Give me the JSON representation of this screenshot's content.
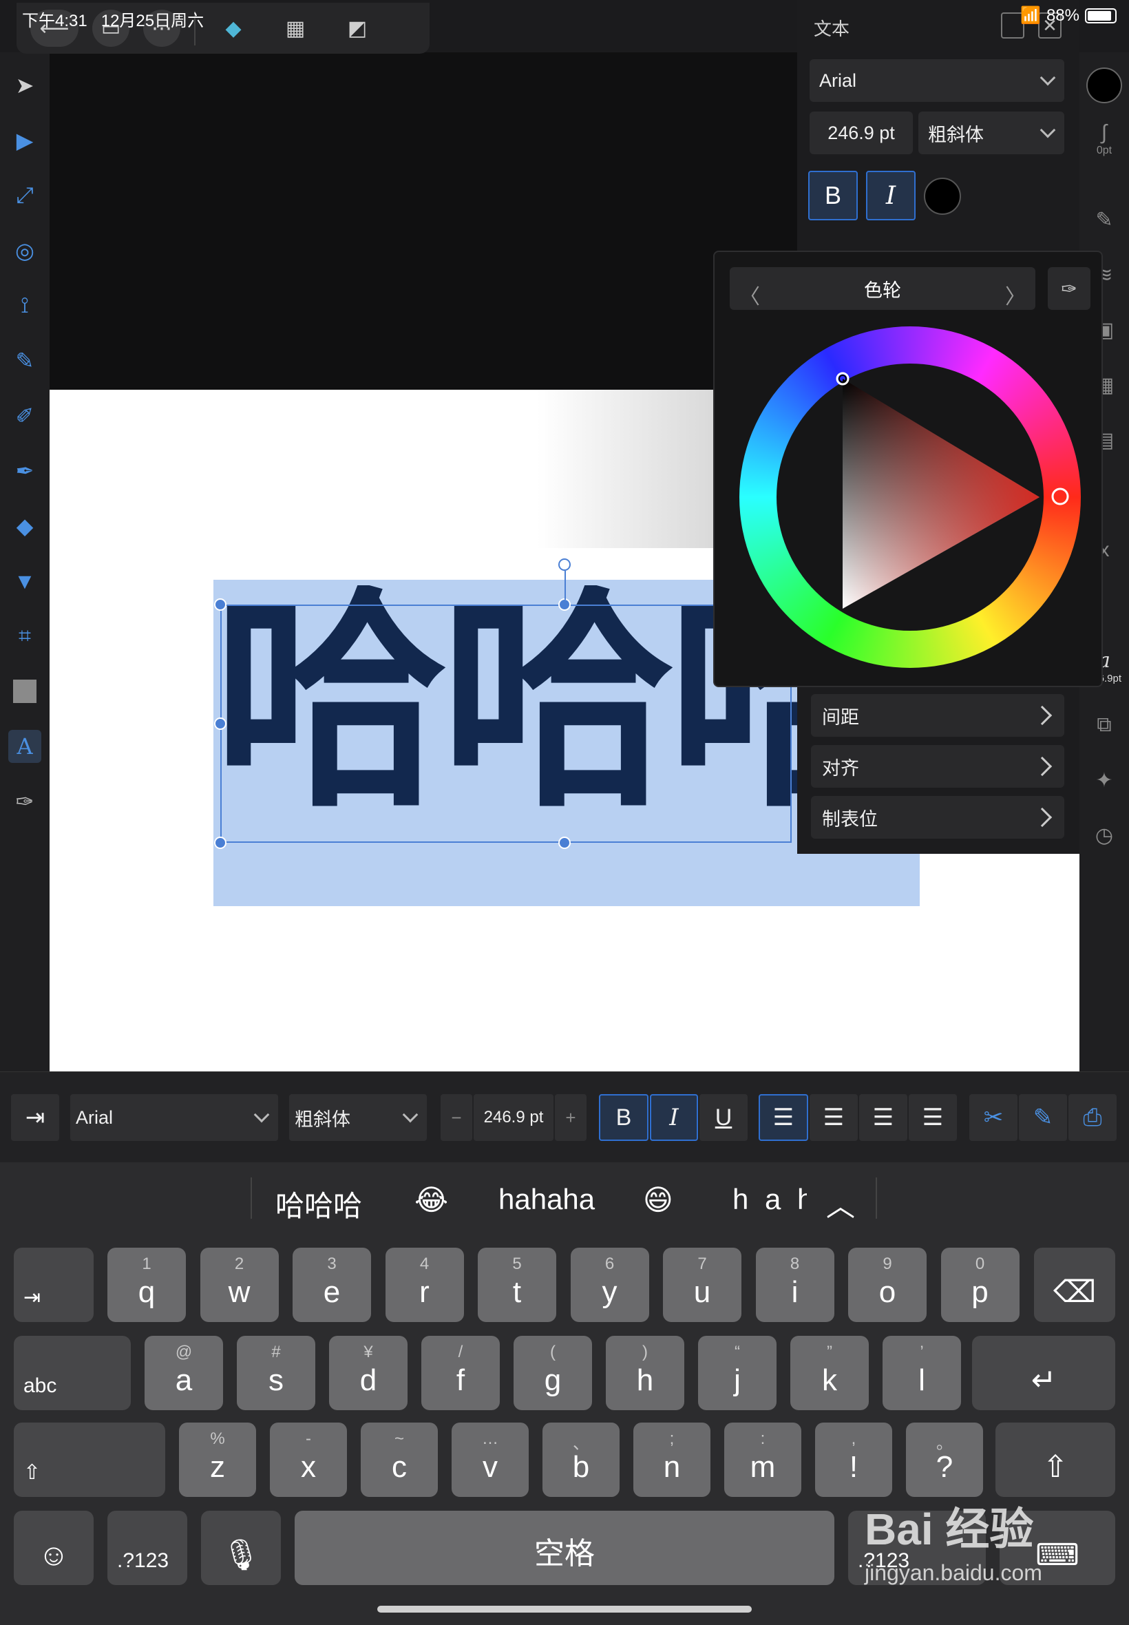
{
  "status": {
    "time": "下午4:31",
    "date": "12月25日周六",
    "battery": "88%"
  },
  "panel": {
    "title": "文本",
    "font": "Arial",
    "size": "246.9 pt",
    "style": "粗斜体",
    "bold": "B",
    "italic": "I",
    "spacing": "间距",
    "align": "对齐",
    "tabs": "制表位"
  },
  "color_popover": {
    "mode": "色轮"
  },
  "canvas": {
    "text": "哈哈哈"
  },
  "right_toolbar": {
    "stroke_width": "0pt",
    "size_label": "246.9pt"
  },
  "context_toolbar": {
    "font": "Arial",
    "style": "粗斜体",
    "size": "246.9 pt",
    "minus": "−",
    "plus": "+",
    "bold": "B",
    "italic": "I",
    "underline": "U"
  },
  "keyboard": {
    "suggestions": [
      "哈哈哈",
      "😂",
      "hahaha",
      "😄",
      "h a h"
    ],
    "row1": [
      [
        "q",
        "1"
      ],
      [
        "w",
        "2"
      ],
      [
        "e",
        "3"
      ],
      [
        "r",
        "4"
      ],
      [
        "t",
        "5"
      ],
      [
        "y",
        "6"
      ],
      [
        "u",
        "7"
      ],
      [
        "i",
        "8"
      ],
      [
        "o",
        "9"
      ],
      [
        "p",
        "0"
      ]
    ],
    "row2": [
      [
        "a",
        "@"
      ],
      [
        "s",
        "#"
      ],
      [
        "d",
        "¥"
      ],
      [
        "f",
        "/"
      ],
      [
        "g",
        "("
      ],
      [
        "h",
        ")"
      ],
      [
        "j",
        "“"
      ],
      [
        "k",
        "”"
      ],
      [
        "l",
        "’"
      ]
    ],
    "row3": [
      [
        "z",
        "%"
      ],
      [
        "x",
        "-"
      ],
      [
        "c",
        "~"
      ],
      [
        "v",
        "…"
      ],
      [
        "b",
        "、"
      ],
      [
        "n",
        ";"
      ],
      [
        "m",
        ":"
      ],
      [
        "!",
        ","
      ],
      [
        "?",
        "。"
      ]
    ],
    "abc": "abc",
    "numbers": ".?123",
    "space": "空格"
  },
  "watermark": {
    "brand": "Bai 经验",
    "url": "jingyan.baidu.com"
  },
  "colors": {
    "accent": "#4a90e2",
    "selection": "#b8d0f2",
    "text_fill": "#12284e"
  }
}
